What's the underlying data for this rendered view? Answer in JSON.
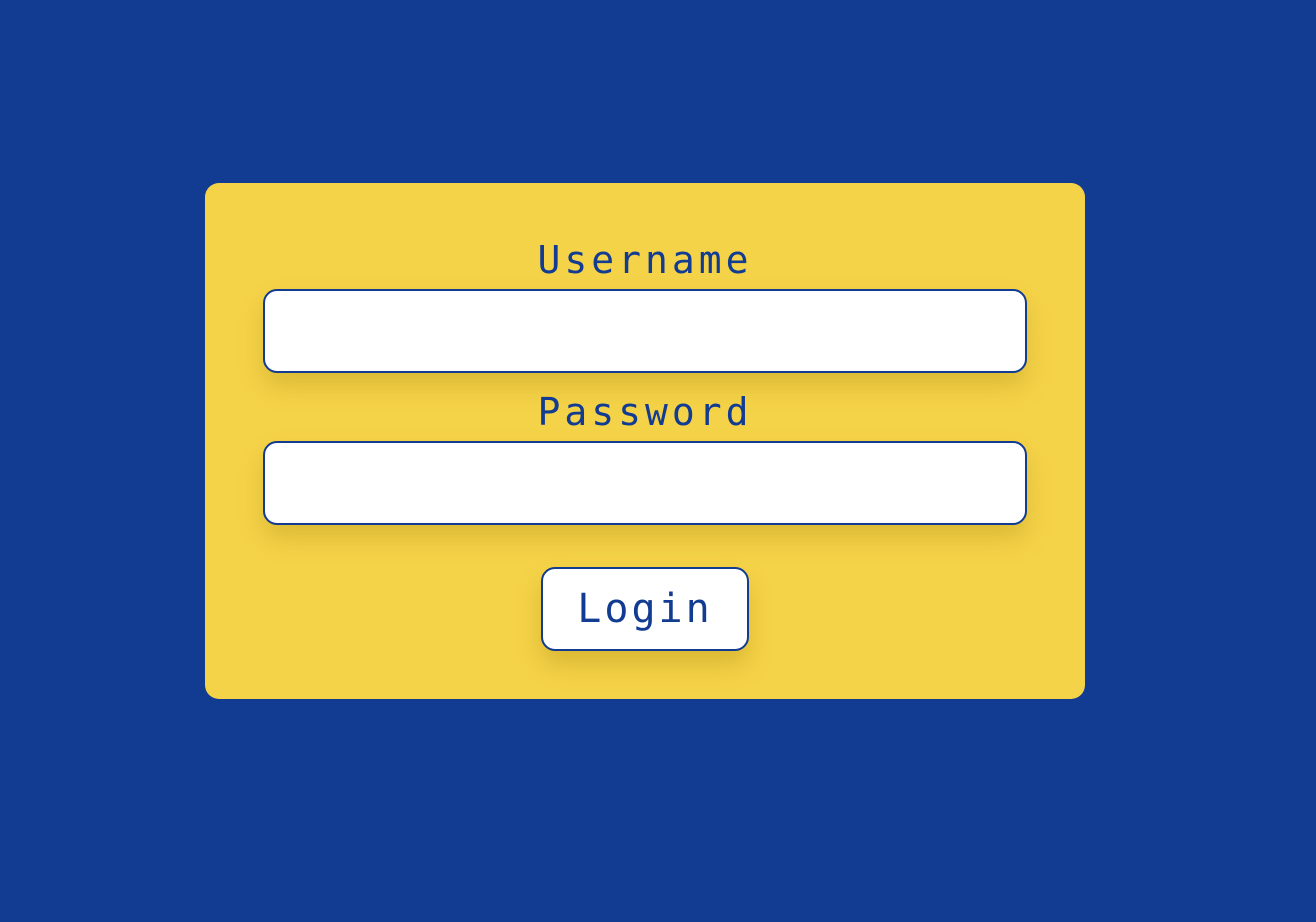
{
  "colors": {
    "background": "#123b92",
    "card": "#f5d348",
    "accent": "#123b92",
    "input_bg": "#ffffff"
  },
  "login_form": {
    "username_label": "Username",
    "username_value": "",
    "username_placeholder": "",
    "password_label": "Password",
    "password_value": "",
    "password_placeholder": "",
    "submit_label": "Login"
  }
}
